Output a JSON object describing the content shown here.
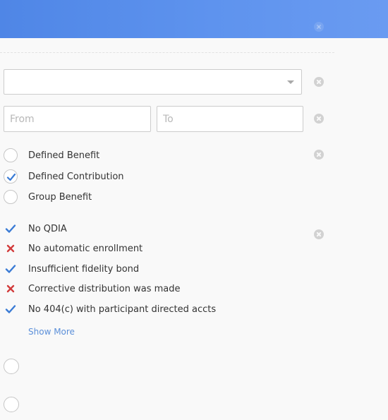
{
  "header": {
    "accent_color": "#5b8fec"
  },
  "filters": {
    "dropdown": {
      "value": ""
    },
    "range": {
      "from_placeholder": "From",
      "to_placeholder": "To"
    },
    "plan_types": [
      {
        "label": "Defined Benefit",
        "selected": false
      },
      {
        "label": "Defined Contribution",
        "selected": true
      },
      {
        "label": "Group Benefit",
        "selected": false
      }
    ],
    "compliance": [
      {
        "label": "No QDIA",
        "state": "check"
      },
      {
        "label": "No automatic enrollment",
        "state": "cross"
      },
      {
        "label": "Insufficient fidelity bond",
        "state": "check"
      },
      {
        "label": "Corrective distribution was made",
        "state": "cross"
      },
      {
        "label": "No 404(c) with participant directed accts",
        "state": "check"
      }
    ],
    "show_more_label": "Show More"
  },
  "colors": {
    "check": "#3a7bd5",
    "cross": "#d23c3c",
    "link": "#5b8fd9"
  }
}
